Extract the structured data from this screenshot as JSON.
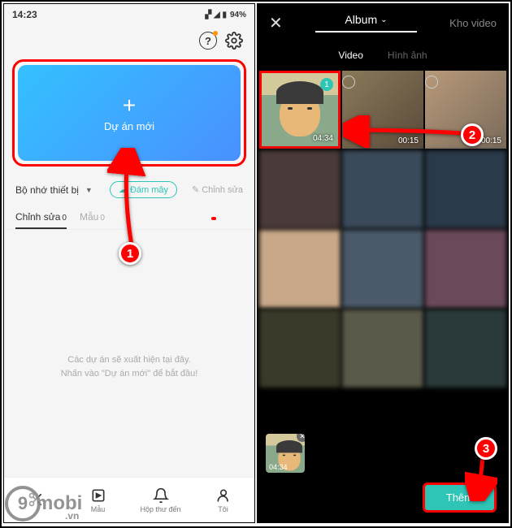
{
  "statusbar": {
    "time": "14:23",
    "battery": "94%"
  },
  "left": {
    "new_project_label": "Dự án mới",
    "storage_label": "Bộ nhớ thiết bị",
    "cloud_label": "Đám mây",
    "edit_label": "Chỉnh sửa",
    "tabs": {
      "edit": "Chỉnh sửa",
      "edit_count": "0",
      "template": "Mẫu",
      "template_count": "0"
    },
    "empty_line1": "Các dự án sẽ xuất hiện tại đây.",
    "empty_line2": "Nhấn vào \"Dự án mới\" để bắt đầu!",
    "nav": {
      "edit": "",
      "template": "Mẫu",
      "inbox": "Hộp thư đến",
      "me": "Tôi"
    }
  },
  "right": {
    "album_label": "Album",
    "kho_label": "Kho video",
    "tab_video": "Video",
    "tab_image": "Hình ảnh",
    "durations": [
      "04:34",
      "00:15",
      "00:15"
    ],
    "selected_badge": "1",
    "tray_duration": "04:34",
    "add_label": "Thêm"
  },
  "steps": {
    "s1": "1",
    "s2": "2",
    "s3": "3"
  },
  "watermark": {
    "nine": "9",
    "text": "mobi",
    "domain": ".vn"
  }
}
